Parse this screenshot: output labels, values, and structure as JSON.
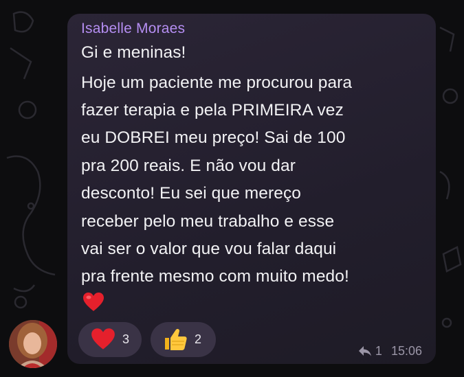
{
  "message": {
    "sender_name": "Isabelle Moraes",
    "lines": [
      "Gi e meninas!",
      "Hoje um paciente me procurou para",
      "fazer terapia e pela PRIMEIRA vez",
      "eu DOBREI meu preço! Sai de 100",
      "pra 200 reais. E não vou dar",
      "desconto! Eu sei que mereço",
      "receber pelo meu trabalho e esse",
      "vai ser o valor que vou falar daqui",
      "pra frente mesmo com muito medo!"
    ],
    "trailing_emoji": "heart-emoji",
    "reactions": [
      {
        "emoji": "heart-emoji",
        "count": "3"
      },
      {
        "emoji": "thumbs-up-emoji",
        "count": "2"
      }
    ],
    "reply_count": "1",
    "time": "15:06"
  },
  "colors": {
    "sender": "#b58ef2",
    "bubble": "#2b2536",
    "reaction_pill": "#3a3346",
    "meta": "#9a95a6"
  }
}
